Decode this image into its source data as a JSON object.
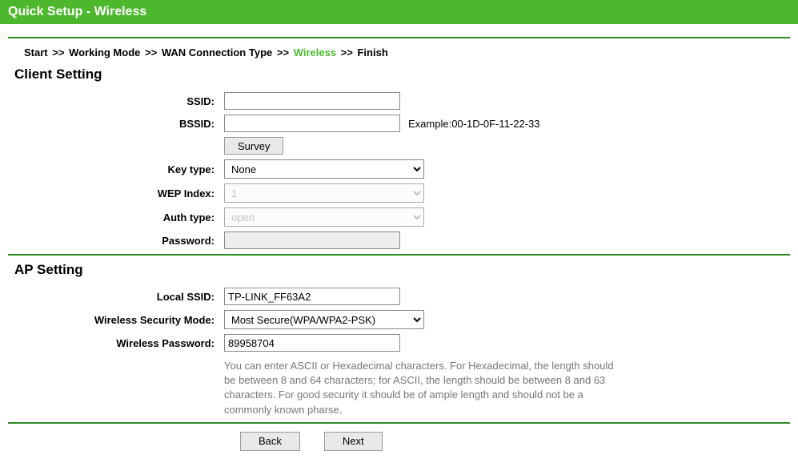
{
  "header": {
    "title": "Quick Setup - Wireless"
  },
  "breadcrumb": {
    "steps": [
      {
        "label": "Start",
        "active": false
      },
      {
        "label": "Working Mode",
        "active": false
      },
      {
        "label": "WAN Connection Type",
        "active": false
      },
      {
        "label": "Wireless",
        "active": true
      },
      {
        "label": "Finish",
        "active": false
      }
    ],
    "separator": ">>"
  },
  "client": {
    "heading": "Client Setting",
    "ssid_label": "SSID:",
    "ssid_value": "",
    "bssid_label": "BSSID:",
    "bssid_value": "",
    "bssid_example": "Example:00-1D-0F-11-22-33",
    "survey_label": "Survey",
    "keytype_label": "Key type:",
    "keytype_value": "None",
    "keytype_options": [
      "None"
    ],
    "wepindex_label": "WEP Index:",
    "wepindex_value": "1",
    "wepindex_options": [
      "1"
    ],
    "authtype_label": "Auth type:",
    "authtype_value": "open",
    "authtype_options": [
      "open"
    ],
    "password_label": "Password:",
    "password_value": ""
  },
  "ap": {
    "heading": "AP Setting",
    "localssid_label": "Local SSID:",
    "localssid_value": "TP-LINK_FF63A2",
    "security_label": "Wireless Security Mode:",
    "security_value": "Most Secure(WPA/WPA2-PSK)",
    "security_options": [
      "Most Secure(WPA/WPA2-PSK)"
    ],
    "password_label": "Wireless Password:",
    "password_value": "89958704",
    "hint": "You can enter ASCII or Hexadecimal characters. For Hexadecimal, the length should be between 8 and 64 characters; for ASCII, the length should be between 8 and 63 characters. For good security it should be of ample length and should not be a commonly known pharse."
  },
  "buttons": {
    "back": "Back",
    "next": "Next"
  }
}
